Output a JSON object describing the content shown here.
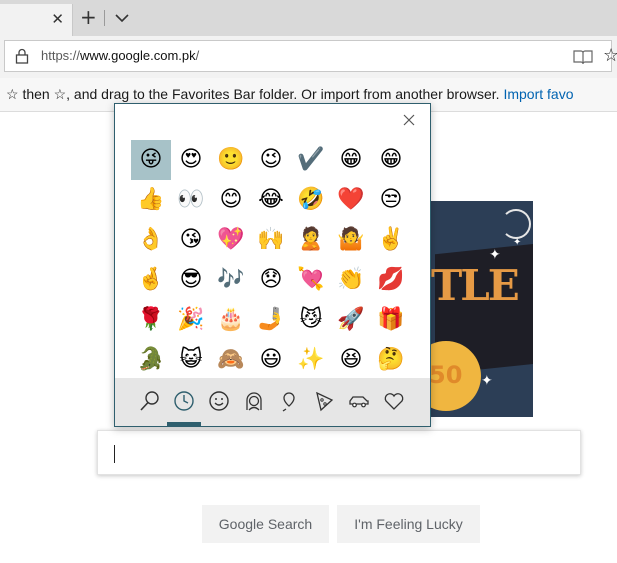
{
  "browser": {
    "tab_close_glyph": "✕",
    "new_tab_glyph": "+",
    "url_prefix": "https://",
    "url_domain": "www.google.com.pk",
    "url_suffix": "/",
    "favorites_glyph": "☆",
    "favbar_text": "☆ then ☆, and drag to the Favorites Bar folder. Or import from another browser.",
    "favbar_link": "Import favo"
  },
  "google": {
    "doodle_letters": "TLE",
    "doodle_sun_text": "50",
    "search_button": "Google Search",
    "lucky_button": "I'm Feeling Lucky"
  },
  "emoji_panel": {
    "emoji_rows": [
      [
        "😜",
        "😍",
        "🙂",
        "😉",
        "✔️",
        "😁",
        "😁"
      ],
      [
        "👍",
        "👀",
        "😊",
        "😂",
        "🤣",
        "❤️",
        "😒"
      ],
      [
        "👌",
        "😘",
        "💖",
        "🙌",
        "🙎",
        "🤷",
        "✌️"
      ],
      [
        "🤞",
        "😎",
        "🎶",
        "😞",
        "💘",
        "👏",
        "💋"
      ],
      [
        "🌹",
        "🎉",
        "🎂",
        "🤳",
        "😼",
        "🚀",
        "🎁"
      ],
      [
        "🐊",
        "😺",
        "🙈",
        "😃",
        "✨",
        "😆",
        "🤔"
      ]
    ],
    "categories": [
      "search",
      "recent",
      "smiley",
      "people",
      "places",
      "food",
      "transport",
      "heart"
    ],
    "active_category": "recent"
  },
  "colors": {
    "panel_border": "#2f5f6e",
    "selected_cell": "#a7c2c8",
    "category_bar": "#e6e6e6",
    "link_blue": "#0063b1"
  }
}
